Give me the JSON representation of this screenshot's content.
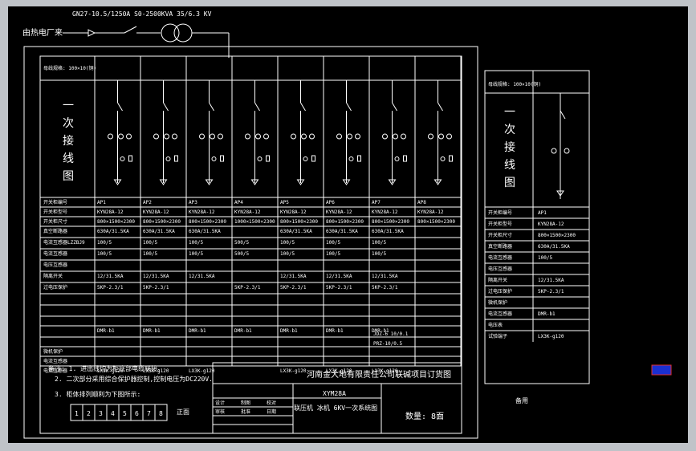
{
  "source": {
    "label": "由热电厂来",
    "transformer": "GN27-10.5/1250A S0-2500KVA 35/6.3 KV"
  },
  "main_panel": {
    "header": "母线规格: 100×10(铜)",
    "vertical_title": [
      "一",
      "次",
      "接",
      "线",
      "图"
    ],
    "row_labels": [
      "开关柜编号",
      "开关柜型号",
      "开关柜尺寸",
      "真空断路器",
      "电流互感器LZZBJ9",
      "电流互感器",
      "电压互感器",
      "隔离开关",
      "过电压保护",
      "",
      "",
      "",
      "",
      "",
      "微机保护",
      "电流互感器",
      "电流互感器",
      "零序电流",
      "电压表",
      "综合保护",
      "试验端子"
    ],
    "cabinets": [
      {
        "no": "AP1",
        "model": "KYN28A-12",
        "size": "800×1500×2300",
        "breaker": "630A/31.5KA",
        "ct1": "100/5",
        "ct2": "100/5",
        "vs": "12/31.5KA",
        "arrester": "5KP-2.3/1",
        "relay": "DMR-b1",
        "cable": "LX3K-g120"
      },
      {
        "no": "AP2",
        "model": "KYN28A-12",
        "size": "800×1500×2300",
        "breaker": "630A/31.5KA",
        "ct1": "100/5",
        "ct2": "100/5",
        "vs": "12/31.5KA",
        "arrester": "5KP-2.3/1",
        "relay": "DMR-b1",
        "cable": "LX3K-g120"
      },
      {
        "no": "AP3",
        "model": "KYN28A-12",
        "size": "800×1500×2300",
        "breaker": "630A/31.5KA",
        "ct1": "100/5",
        "ct2": "100/5",
        "vs": "12/31.5KA",
        "arrester": "",
        "relay": "DMR-b1",
        "cable": "LX3K-g120"
      },
      {
        "no": "AP4",
        "model": "KYN28A-12",
        "size": "1000×1500×2300",
        "breaker": "",
        "ct1": "500/5",
        "ct2": "500/5",
        "vs": "",
        "arrester": "5KP-2.3/1",
        "relay": "DMR-b1",
        "cable": ""
      },
      {
        "no": "AP5",
        "model": "KYN28A-12",
        "size": "800×1500×2300",
        "breaker": "630A/31.5KA",
        "ct1": "100/5",
        "ct2": "100/5",
        "vs": "12/31.5KA",
        "arrester": "5KP-2.3/1",
        "relay": "DMR-b1",
        "cable": "LX3K-g120"
      },
      {
        "no": "AP6",
        "model": "KYN28A-12",
        "size": "800×1500×2300",
        "breaker": "630A/31.5KA",
        "ct1": "100/5",
        "ct2": "100/5",
        "vs": "12/31.5KA",
        "arrester": "5KP-2.3/1",
        "relay": "DMR-b1",
        "cable": "LX3K-g120"
      },
      {
        "no": "AP7",
        "model": "KYN28A-12",
        "size": "800×1500×2300",
        "breaker": "630A/31.5KA",
        "ct1": "100/5",
        "ct2": "100/5",
        "vs": "12/31.5KA",
        "arrester": "5KP-2.3/1",
        "relay": "DMR-b1",
        "cable": "LX3K-g120"
      },
      {
        "no": "AP8",
        "model": "KYN28A-12",
        "size": "800×1500×2300",
        "breaker": "",
        "ct1": "",
        "ct2": "",
        "vs": "",
        "arrester": "",
        "relay": "",
        "cable": ""
      }
    ],
    "pt_note": "JDZ-6 10/0.1",
    "pt_note2": "PRZ-10/0.5"
  },
  "notes": {
    "note1": "备注: 1. 进出线均为柜底部电缆联接。",
    "note2": "2. 二次部分采用综合保护器控制,控制电压为DC220V.",
    "note3": "3. 柜体排列顺利为下图所示:",
    "order_cells": [
      "1",
      "2",
      "3",
      "4",
      "5",
      "6",
      "7",
      "8"
    ],
    "front_label": "正面"
  },
  "title_block": {
    "company": "河南金大地有限责任公司联碱项目订货图",
    "drawing_no": "XYM28A",
    "drawing_title": "联压机 冰机 6KV一次系统图",
    "quantity": "数量: 8面",
    "small_labels": [
      "设计",
      "制图",
      "校对",
      "审核",
      "批准",
      "日期"
    ]
  },
  "side_panel": {
    "header": "母线规格: 100×10(铜)",
    "vertical_title": [
      "一",
      "次",
      "接",
      "线",
      "图"
    ],
    "rows": [
      {
        "label": "开关柜编号",
        "value": "AP1"
      },
      {
        "label": "开关柜型号",
        "value": "KYN28A-12"
      },
      {
        "label": "开关柜尺寸",
        "value": "800×1500×2300"
      },
      {
        "label": "真空断路器",
        "value": "630A/31.5KA"
      },
      {
        "label": "电流互感器",
        "value": "100/5"
      },
      {
        "label": "电压互感器",
        "value": ""
      },
      {
        "label": "隔离开关",
        "value": "12/31.5KA"
      },
      {
        "label": "过电压保护",
        "value": "5KP-2.3/1"
      },
      {
        "label": "微机保护",
        "value": ""
      },
      {
        "label": "电流互感器",
        "value": "DMR-b1"
      },
      {
        "label": "电压表",
        "value": ""
      },
      {
        "label": "试验端子",
        "value": "LX3K-g120"
      }
    ],
    "footer": "备用"
  }
}
